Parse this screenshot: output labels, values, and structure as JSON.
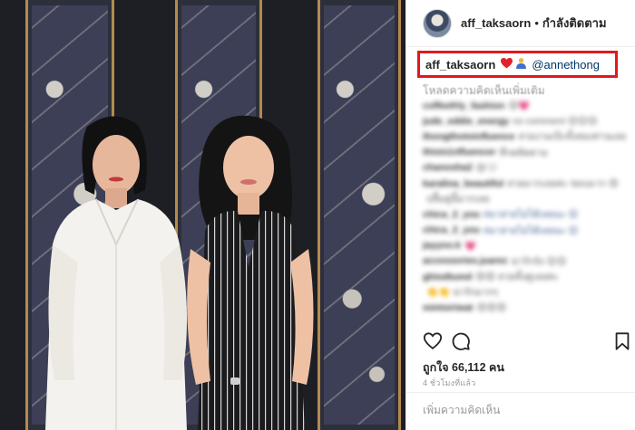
{
  "header": {
    "username": "aff_taksaorn",
    "separator": "•",
    "follow_label": "กำลังติดตาม"
  },
  "caption": {
    "username": "aff_taksaorn",
    "mention": "@annethong"
  },
  "load_more_label": "โหลดความคิดเห็นเพิ่มเติม",
  "comments": [
    {
      "user": "coffeefrly_fashion",
      "text": "😍💗"
    },
    {
      "user": "jude_eddie_energy",
      "text": "no comment 😊😊😊"
    },
    {
      "user": "thongthotoinfluence",
      "text": "สวยงามเป๊ะทั้งสองท่านเลยค่ะ 🖤"
    },
    {
      "user": "thisis1nfluencer",
      "text": "ที่กดติดตาม"
    },
    {
      "user": "chanosha2",
      "text": "😍🤍"
    },
    {
      "user": "karalina_beautiful",
      "text": "สวยมากเลยค่ะ ชอบมาก 😍"
    },
    {
      "user": "",
      "text": "ปลื้มคู่นี้มากเลย"
    },
    {
      "user": "chica_2_you",
      "text": "#มาสายไม่ได้เลยนะ 😊"
    },
    {
      "user": "chica_2_you",
      "text": "#มาสายไม่ได้เลยนะ 😊"
    },
    {
      "user": "jayyoo.k",
      "text": "💗"
    },
    {
      "user": "accessories.juarez",
      "text": "น่ารักจัง 😊😊"
    },
    {
      "user": "ghiodtumd",
      "text": "😍😍 สวยทั้งคู่เลยค่ะ"
    },
    {
      "user": "",
      "text": "👏👏 น่ารักมากๆ"
    },
    {
      "user": "mintsiriwat",
      "text": "😍😍😍"
    }
  ],
  "likes_text": "ถูกใจ 66,112 คน",
  "timestamp": "4 ชั่วโมงที่แล้ว",
  "add_comment_placeholder": "เพิ่มความคิดเห็น",
  "icons": {
    "like": "heart-outline-icon",
    "comment": "speech-bubble-icon",
    "save": "bookmark-icon",
    "caption_heart": "red-heart-emoji",
    "caption_person": "person-emoji"
  },
  "colors": {
    "highlight_box": "#e0191f",
    "mention": "#003569",
    "muted": "#999999"
  }
}
